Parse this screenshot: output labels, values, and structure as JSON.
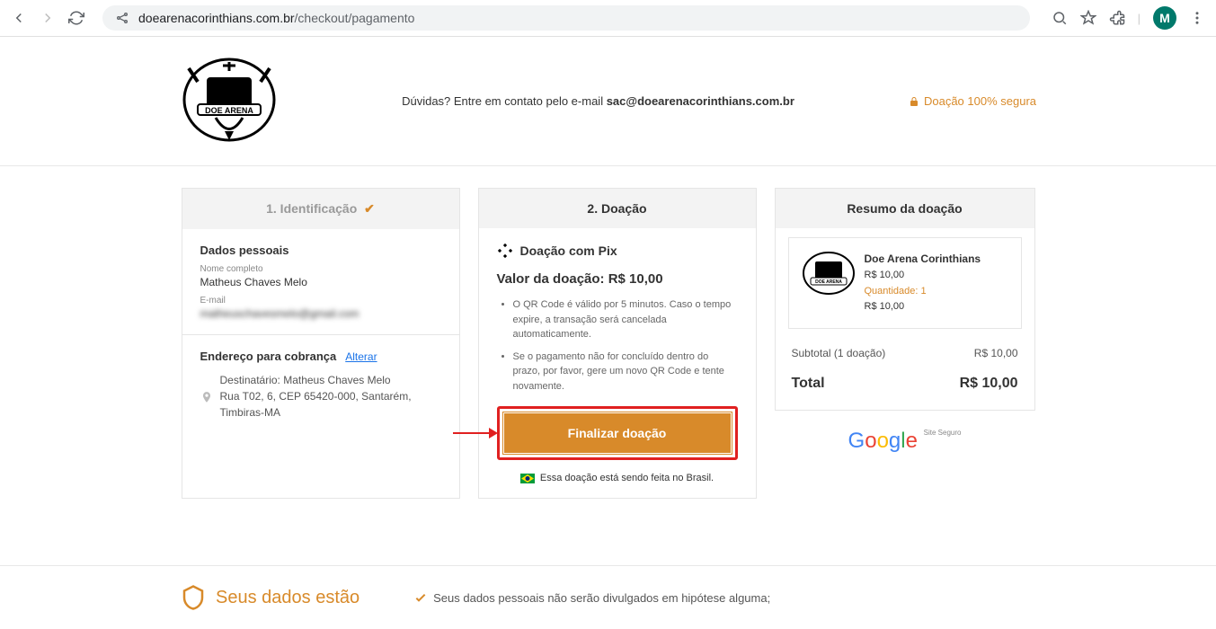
{
  "browser": {
    "url_domain": "doearenacorinthians.com.br",
    "url_path": "/checkout/pagamento",
    "avatar_letter": "M"
  },
  "header": {
    "contact_prefix": "Dúvidas? Entre em contato pelo e-mail ",
    "contact_email": "sac@doearenacorinthians.com.br",
    "secure_label": "Doação 100% segura"
  },
  "step1": {
    "title": "1. Identificação",
    "section_personal": "Dados pessoais",
    "name_label": "Nome completo",
    "name_value": "Matheus Chaves Melo",
    "email_label": "E-mail",
    "email_value": "matheuschavesmelo@gmail.com",
    "section_billing": "Endereço para cobrança",
    "alterar": "Alterar",
    "address_line1": "Destinatário: Matheus Chaves Melo",
    "address_line2": "Rua T02, 6, CEP 65420-000, Santarém, Timbiras-MA"
  },
  "step2": {
    "title": "2. Doação",
    "pix_label": "Doação com Pix",
    "valor_label": "Valor da doação: R$ 10,00",
    "bullet1": "O QR Code é válido por 5 minutos. Caso o tempo expire, a transação será cancelada automaticamente.",
    "bullet2": "Se o pagamento não for concluído dentro do prazo, por favor, gere um novo QR Code e tente novamente.",
    "finalize_btn": "Finalizar doação",
    "brazil_note": "Essa doação está sendo feita no Brasil."
  },
  "summary": {
    "title": "Resumo da doação",
    "product_name": "Doe Arena Corinthians",
    "product_price": "R$ 10,00",
    "qty_label": "Quantidade: 1",
    "qty_price": "R$ 10,00",
    "subtotal_label": "Subtotal (1 doação)",
    "subtotal_value": "R$ 10,00",
    "total_label": "Total",
    "total_value": "R$ 10,00",
    "site_seguro": "Site Seguro"
  },
  "footer": {
    "left_text": "Seus dados estão",
    "right_text": "Seus dados pessoais não serão divulgados em hipótese alguma;"
  }
}
